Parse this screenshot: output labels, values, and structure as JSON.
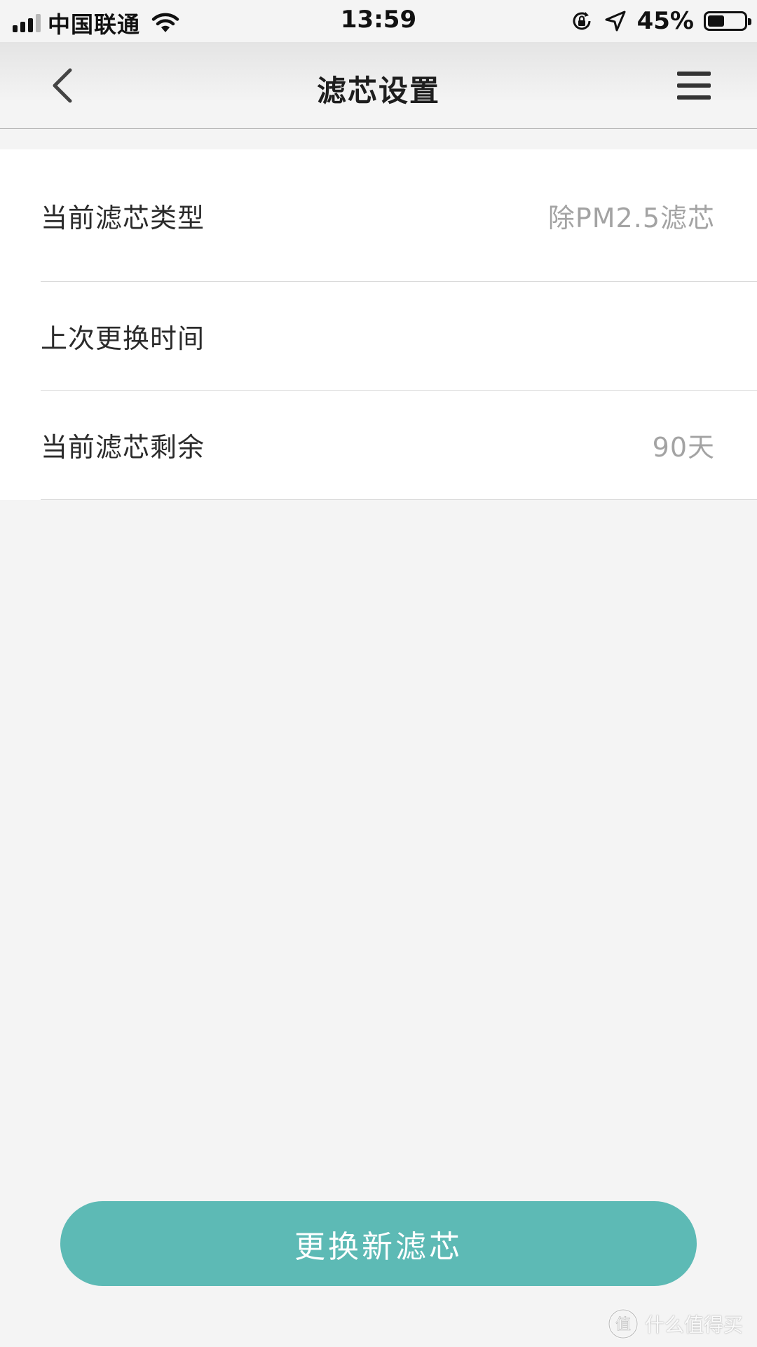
{
  "status_bar": {
    "carrier": "中国联通",
    "time": "13:59",
    "battery_percent": "45%",
    "battery_level": 0.45,
    "icons": [
      "signal-icon",
      "wifi-icon",
      "rotation-lock-icon",
      "location-icon",
      "battery-icon"
    ]
  },
  "nav": {
    "title": "滤芯设置",
    "back_icon": "chevron-left-icon",
    "menu_icon": "hamburger-menu-icon"
  },
  "settings": {
    "rows": [
      {
        "label": "当前滤芯类型",
        "value": "除PM2.5滤芯"
      },
      {
        "label": "上次更换时间",
        "value": ""
      },
      {
        "label": "当前滤芯剩余",
        "value": "90天"
      }
    ]
  },
  "actions": {
    "replace_button_label": "更换新滤芯"
  },
  "colors": {
    "accent": "#5dbab5",
    "background": "#f4f4f4",
    "value_text": "#a3a3a3"
  },
  "watermark": {
    "text": "什么值得买"
  }
}
